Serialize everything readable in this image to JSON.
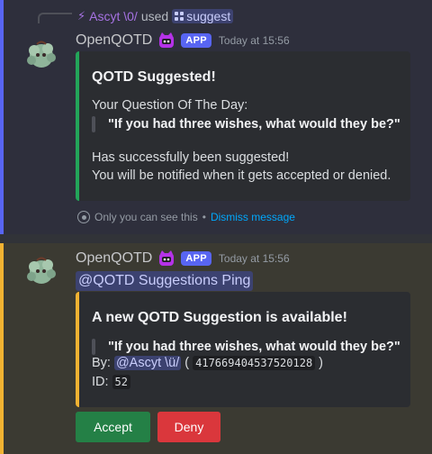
{
  "message1": {
    "reply": {
      "user": "Ascyt \\0/",
      "used_text": "used",
      "command": "suggest"
    },
    "author": "OpenQOTD",
    "badge": "APP",
    "timestamp": "Today at 15:56",
    "embed": {
      "title": "QOTD Suggested!",
      "line1": "Your Question Of The Day:",
      "question": "\"If you had three wishes, what would they be?\"",
      "line2": "Has successfully been suggested!",
      "line3": "You will be notified when it gets accepted or denied.",
      "accent_color": "#23a55a"
    },
    "ephemeral_text": "Only you can see this",
    "separator": "•",
    "dismiss_text": "Dismiss message"
  },
  "message2": {
    "author": "OpenQOTD",
    "badge": "APP",
    "timestamp": "Today at 15:56",
    "ping": "@QOTD Suggestions Ping",
    "embed": {
      "title": "A new QOTD Suggestion is available!",
      "question": "\"If you had three wishes, what would they be?\"",
      "by_label": "By:",
      "by_mention": "@Ascyt \\ü/",
      "open_paren": "(",
      "user_id": "417669404537520128",
      "close_paren": ")",
      "id_label": "ID:",
      "id_value": "52",
      "accent_color": "#f0b232"
    },
    "buttons": {
      "accept": "Accept",
      "deny": "Deny"
    }
  },
  "colors": {
    "background": "#313338",
    "blurple": "#5865f2",
    "success": "#248046",
    "danger": "#da373c"
  }
}
